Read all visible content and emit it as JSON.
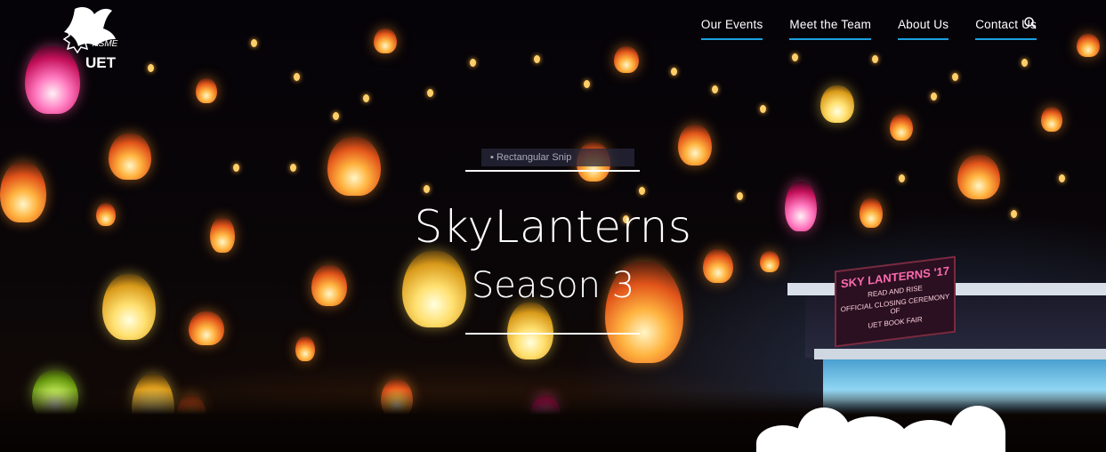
{
  "logo": {
    "name": "ASME UET",
    "asme": "ASME",
    "uet": "UET"
  },
  "nav": {
    "items": [
      {
        "label": "Our Events"
      },
      {
        "label": "Meet the Team"
      },
      {
        "label": "About Us"
      },
      {
        "label": "Contact Us"
      }
    ],
    "search_icon": "search-icon",
    "accent": "#1aa0e0"
  },
  "hero": {
    "chip_text": "Rectangular Snip",
    "title": "SkyLanterns",
    "subtitle": "Season 3",
    "banner": {
      "title": "SKY LANTERNS '17",
      "line1": "READ AND RISE",
      "line2": "OFFICIAL CLOSING CEREMONY OF",
      "line3": "UET BOOK FAIR"
    }
  }
}
